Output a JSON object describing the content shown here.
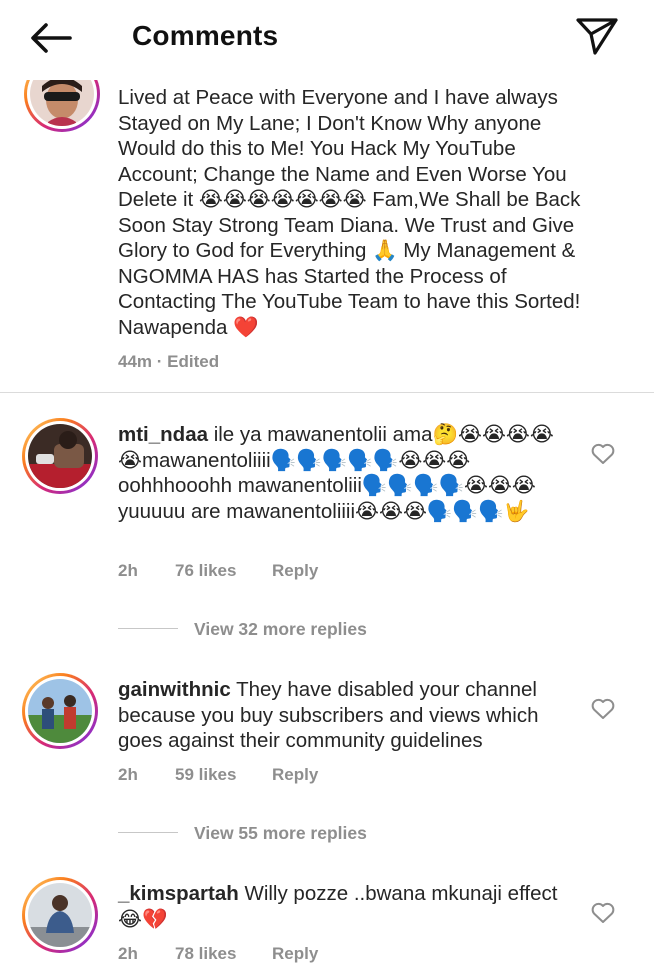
{
  "header": {
    "title": "Comments"
  },
  "caption": {
    "text": "Lived at Peace with Everyone and I have always Stayed on My Lane; I Don't Know Why anyone Would do this to Me! You Hack My YouTube Account; Change the Name and Even Worse You Delete it 😭😭😭😭😭😭😭 Fam,We Shall be Back Soon Stay Strong Team Diana. We Trust and Give Glory to God for Everything 🙏 My Management & NGOMMA HAS has Started the Process of Contacting The YouTube Team to have this Sorted! Nawapenda ❤️",
    "time": "44m",
    "separator": "·",
    "edited": "Edited"
  },
  "comments": [
    {
      "username": "mti_ndaa",
      "text": " ile ya mawanentolii ama🤔😭😭😭😭😭mawanentoliiii🗣️🗣️🗣️🗣️🗣️😭😭😭 oohhhooohh mawanentoliii🗣️🗣️🗣️🗣️😭😭😭yuuuuu are mawanentoliiii😭😭😭🗣️🗣️🗣️🤟",
      "time": "2h",
      "likes": "76 likes",
      "reply": "Reply",
      "view_replies": "View 32 more replies"
    },
    {
      "username": "gainwithnic",
      "text": " They have disabled your channel because you buy subscribers and views which goes against their community guidelines",
      "time": "2h",
      "likes": "59 likes",
      "reply": "Reply",
      "view_replies": "View 55 more replies"
    },
    {
      "username": "_kimspartah",
      "text": " Willy pozze ..bwana mkunaji effect 😂💔",
      "time": "2h",
      "likes": "78 likes",
      "reply": "Reply"
    }
  ],
  "icons": {
    "back": "arrow-left-icon",
    "send": "paper-plane-icon",
    "like": "heart-outline-icon"
  }
}
